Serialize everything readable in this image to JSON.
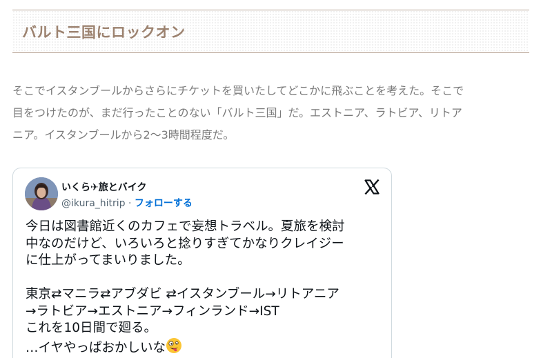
{
  "heading": {
    "title": "バルト三国にロックオン"
  },
  "article": {
    "lines": [
      "そこでイスタンブールからさらにチケットを買いたしてどこかに飛ぶことを考えた。そこで",
      "目をつけたのが、まだ行ったことのない「バルト三国」だ。エストニア、ラトビア、リトア",
      "ニア。イスタンブールから2〜3時間程度だ。"
    ]
  },
  "tweet": {
    "author_name": "いくら✈旅とバイク",
    "handle": "@ikura_hitrip",
    "separator": " · ",
    "follow_label": "フォローする",
    "logo_icon": "x-logo-icon",
    "avatar_icon": "avatar-photo",
    "text_lines": [
      "今日は図書館近くのカフェで妄想トラベル。夏旅を検討",
      "中なのだけど、いろいろと捻りすぎてかなりクレイジー",
      "に仕上がってまいりました。",
      "",
      "東京⇄マニラ⇄アブダビ ⇄イスタンブール→リトアニア",
      "→ラトビア→エストニア→フィンランド→IST",
      "これを10日間で廻る。",
      "…イヤやっぱおかしいな"
    ],
    "end_emoji": "zany-face-emoji"
  },
  "colors": {
    "heading_text": "#9c826f",
    "heading_border": "#b49f8f",
    "body_text": "#7a7a7a",
    "tweet_text": "#0f1419",
    "tweet_meta": "#536471",
    "follow_link": "#006fd6",
    "card_border": "#cfd9de"
  }
}
